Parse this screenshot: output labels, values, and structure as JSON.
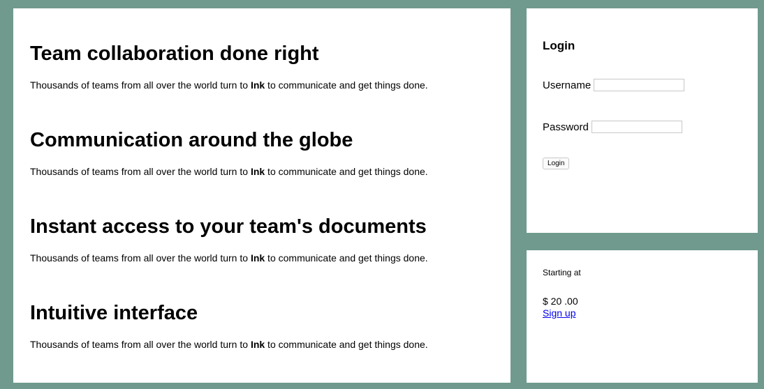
{
  "features": [
    {
      "title": "Team collaboration done right",
      "desc_pre": "Thousands of teams from all over the world turn to ",
      "desc_brand": "Ink",
      "desc_post": " to communicate and get things done."
    },
    {
      "title": "Communication around the globe",
      "desc_pre": "Thousands of teams from all over the world turn to ",
      "desc_brand": "Ink",
      "desc_post": " to communicate and get things done."
    },
    {
      "title": "Instant access to your team's documents",
      "desc_pre": "Thousands of teams from all over the world turn to ",
      "desc_brand": "Ink",
      "desc_post": " to communicate and get things done."
    },
    {
      "title": "Intuitive interface",
      "desc_pre": "Thousands of teams from all over the world turn to ",
      "desc_brand": "Ink",
      "desc_post": " to communicate and get things done."
    }
  ],
  "login": {
    "title": "Login",
    "username_label": "Username",
    "username_value": "",
    "password_label": "Password",
    "password_value": "",
    "button_label": "Login"
  },
  "pricing": {
    "starting_label": "Starting at",
    "price": "$ 20 .00",
    "signup_label": "Sign up"
  },
  "colors": {
    "background": "#6f9a8d",
    "panel": "#ffffff",
    "link": "#0000ee"
  }
}
